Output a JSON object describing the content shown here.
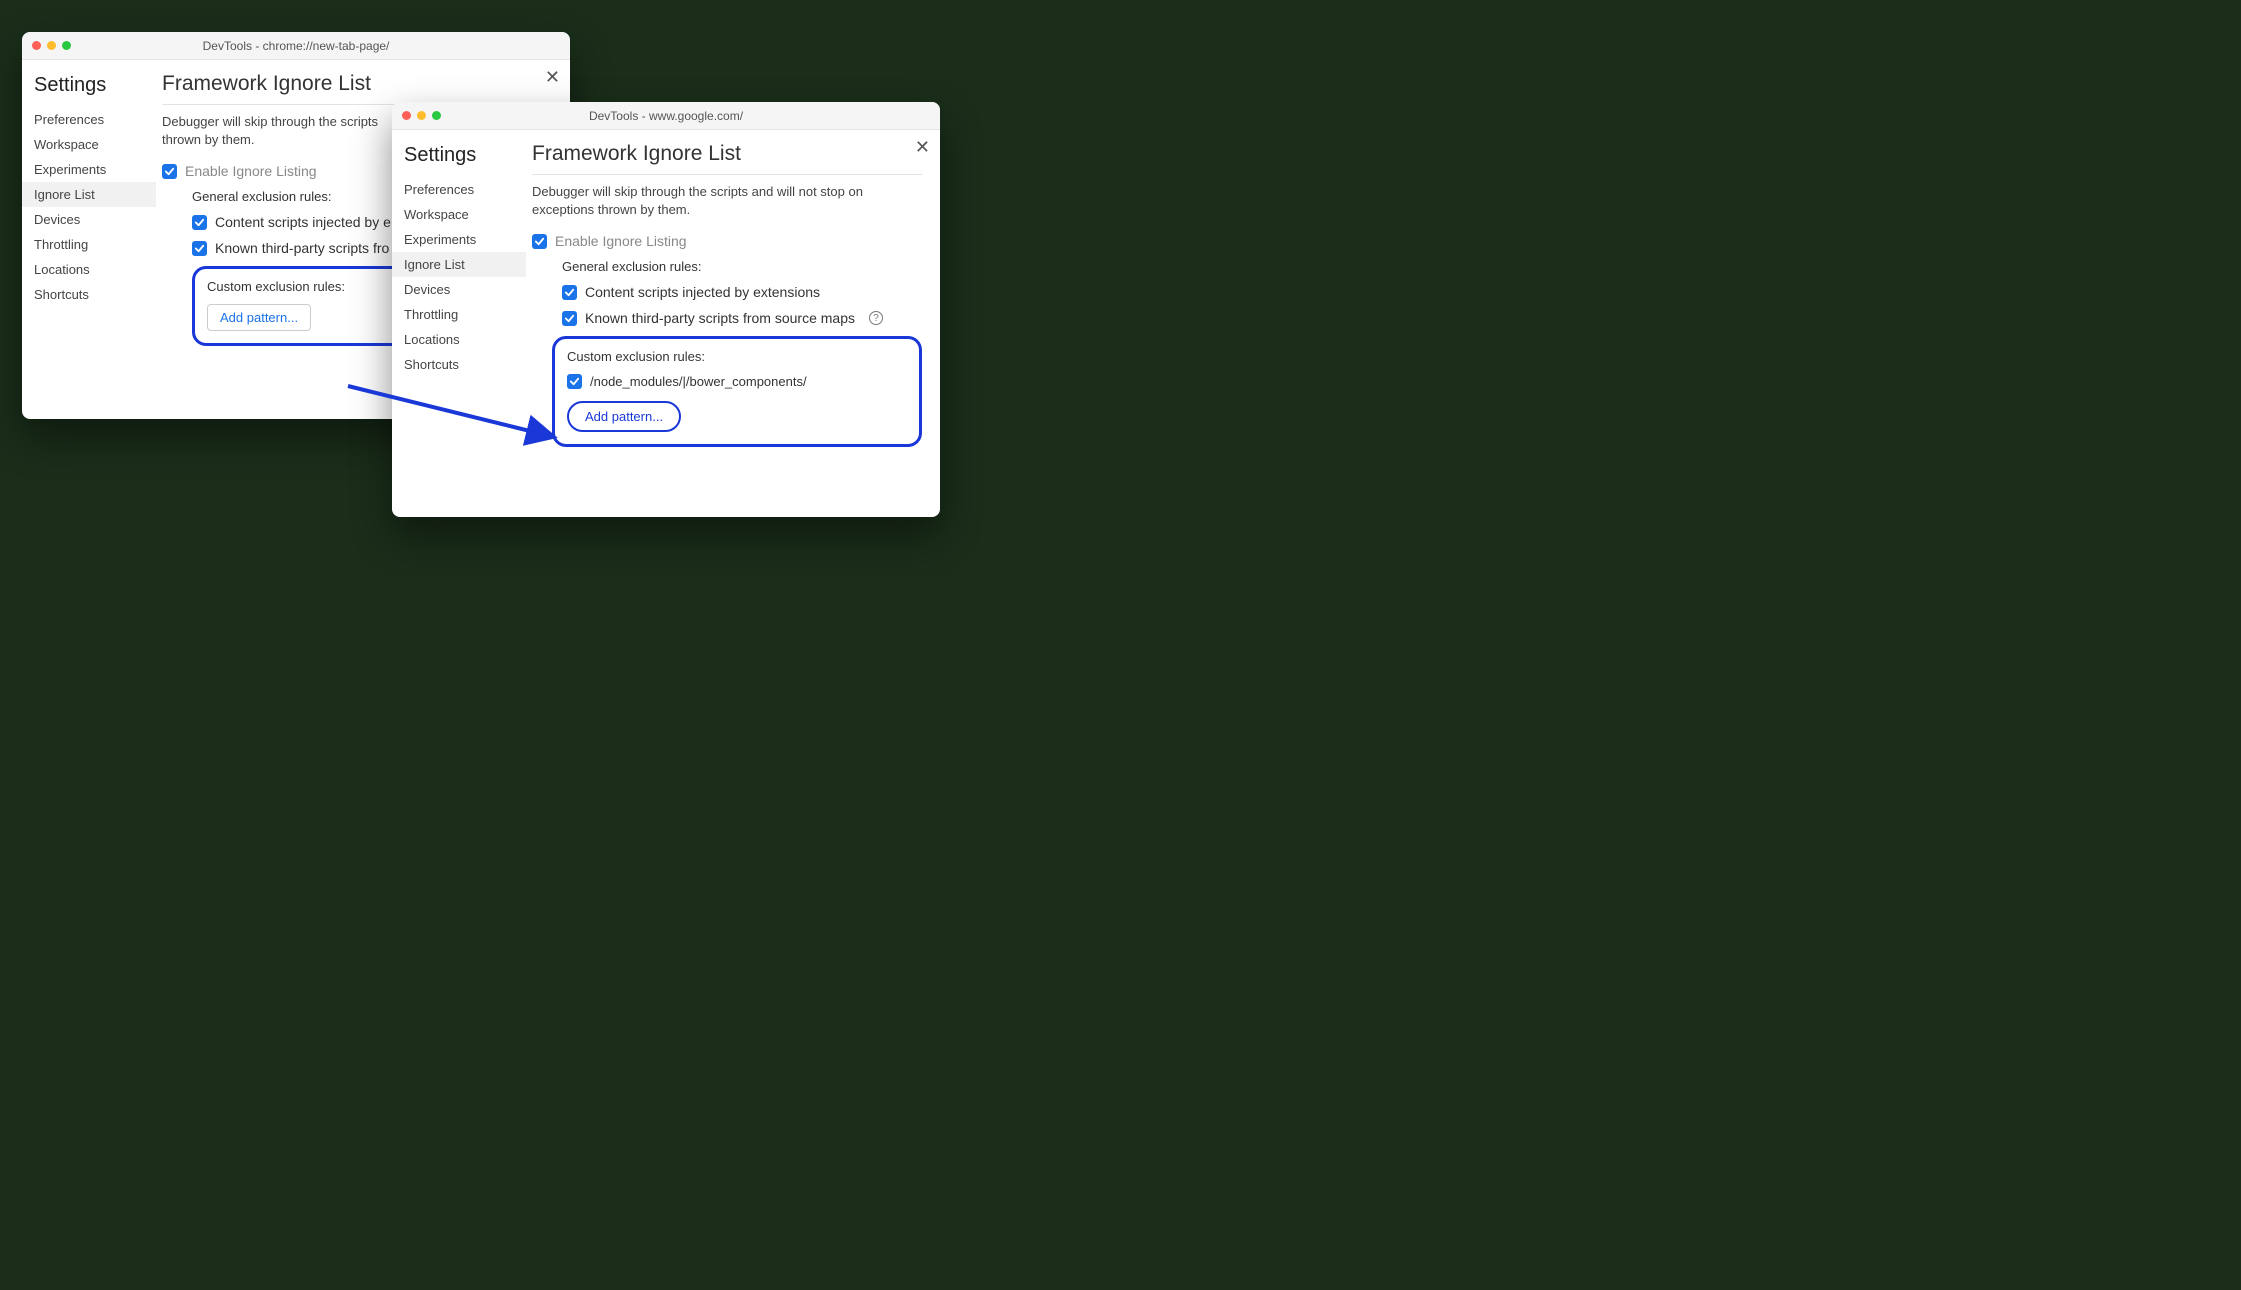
{
  "window_a": {
    "title": "DevTools - chrome://new-tab-page/",
    "settings_title": "Settings",
    "sidebar": {
      "items": [
        {
          "label": "Preferences"
        },
        {
          "label": "Workspace"
        },
        {
          "label": "Experiments"
        },
        {
          "label": "Ignore List"
        },
        {
          "label": "Devices"
        },
        {
          "label": "Throttling"
        },
        {
          "label": "Locations"
        },
        {
          "label": "Shortcuts"
        }
      ],
      "selected_index": 3
    },
    "main": {
      "title": "Framework Ignore List",
      "description": "Debugger will skip through the scripts and will not stop on exceptions thrown by them.",
      "description_visible": "Debugger will skip through the scripts",
      "description_line2": "thrown by them.",
      "enable_label": "Enable Ignore Listing",
      "general_title": "General exclusion rules:",
      "rule_content_scripts": "Content scripts injected by extensions",
      "rule_content_scripts_visible": "Content scripts injected by e",
      "rule_third_party": "Known third-party scripts from source maps",
      "rule_third_party_visible": "Known third-party scripts fro",
      "custom_title": "Custom exclusion rules:",
      "add_pattern_label": "Add pattern..."
    }
  },
  "window_b": {
    "title": "DevTools - www.google.com/",
    "settings_title": "Settings",
    "sidebar": {
      "items": [
        {
          "label": "Preferences"
        },
        {
          "label": "Workspace"
        },
        {
          "label": "Experiments"
        },
        {
          "label": "Ignore List"
        },
        {
          "label": "Devices"
        },
        {
          "label": "Throttling"
        },
        {
          "label": "Locations"
        },
        {
          "label": "Shortcuts"
        }
      ],
      "selected_index": 3
    },
    "main": {
      "title": "Framework Ignore List",
      "description": "Debugger will skip through the scripts and will not stop on exceptions thrown by them.",
      "enable_label": "Enable Ignore Listing",
      "general_title": "General exclusion rules:",
      "rule_content_scripts": "Content scripts injected by extensions",
      "rule_third_party": "Known third-party scripts from source maps",
      "custom_title": "Custom exclusion rules:",
      "custom_pattern": "/node_modules/|/bower_components/",
      "add_pattern_label": "Add pattern..."
    }
  },
  "colors": {
    "accent": "#1a73e8",
    "highlight": "#1a38d8"
  }
}
